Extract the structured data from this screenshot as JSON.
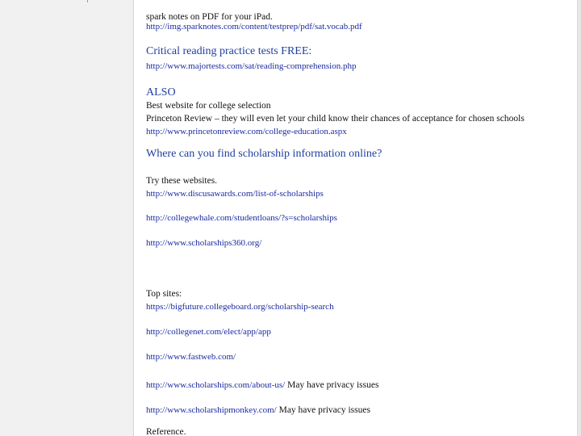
{
  "document": {
    "lines": [
      {
        "kind": "body",
        "text": "spark notes on PDF for your iPad."
      },
      {
        "kind": "link",
        "text": "http://img.sparknotes.com/content/testprep/pdf/sat.vocab.pdf"
      },
      {
        "kind": "heading",
        "text": "Critical reading practice tests FREE:"
      },
      {
        "kind": "link",
        "text": "http://www.majortests.com/sat/reading-comprehension.php"
      },
      {
        "kind": "heading",
        "text": "ALSO"
      },
      {
        "kind": "body",
        "text": "Best website for college selection"
      },
      {
        "kind": "body",
        "text": "Princeton Review – they will even let your child know their chances of acceptance for chosen schools"
      },
      {
        "kind": "link",
        "text": "http://www.princetonreview.com/college-education.aspx"
      },
      {
        "kind": "heading",
        "text": "Where can you find scholarship information online?"
      },
      {
        "kind": "body",
        "text": "Try these websites."
      },
      {
        "kind": "link",
        "text": "http://www.discusawards.com/list-of-scholarships"
      },
      {
        "kind": "link",
        "text": "http://collegewhale.com/studentloans/?s=scholarships"
      },
      {
        "kind": "link",
        "text": "http://www.scholarships360.org/"
      },
      {
        "kind": "body",
        "text": "Top sites:"
      },
      {
        "kind": "link",
        "text": "https://bigfuture.collegeboard.org/scholarship-search"
      },
      {
        "kind": "link",
        "text": "http://collegenet.com/elect/app/app"
      },
      {
        "kind": "link",
        "text": "http://www.fastweb.com/"
      },
      {
        "kind": "link",
        "text": "http://www.scholarships.com/about-us/",
        "note": "  May have privacy issues"
      },
      {
        "kind": "link",
        "text": "http://www.scholarshipmonkey.com/",
        "note": "  May have privacy issues"
      },
      {
        "kind": "body",
        "text": "Reference."
      }
    ]
  }
}
